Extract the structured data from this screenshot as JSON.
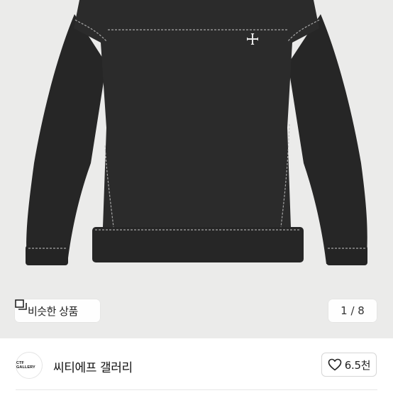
{
  "product": {
    "image_name": "black-sweatshirt-photo",
    "logo_icon": "cross-icon"
  },
  "similar_button": {
    "icon": "similar-items-icon",
    "label": "비슷한 상품"
  },
  "gallery": {
    "counter": "1 / 8"
  },
  "seller": {
    "avatar_text": "CTF GALLERY",
    "name": "씨티에프 갤러리"
  },
  "like": {
    "icon": "heart-icon",
    "count": "6.5천"
  },
  "colors": {
    "background": "#ebebea",
    "garment": "#2a2a2a"
  }
}
